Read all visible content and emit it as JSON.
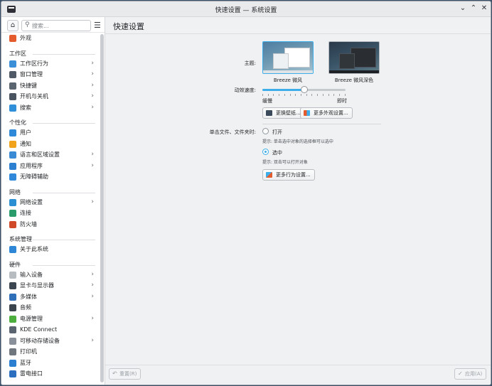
{
  "window": {
    "title": "快速设置 — 系统设置"
  },
  "titlebar": {
    "min_icon": "⌄",
    "max_icon": "⌃",
    "close_icon": "✕"
  },
  "sidebar": {
    "home_icon": "⌂",
    "search_placeholder": "搜索...",
    "search_icon": "⚲",
    "menu_icon": "☰",
    "top_item": {
      "label": "外观",
      "icon_color": "#e45c2e"
    },
    "sections": [
      {
        "title": "工作区",
        "items": [
          {
            "label": "工作区行为",
            "arrow": true,
            "icon_color": "#3b8fd6"
          },
          {
            "label": "窗口管理",
            "arrow": true,
            "icon_color": "#4f5a66"
          },
          {
            "label": "快捷键",
            "arrow": true,
            "icon_color": "#5b6570"
          },
          {
            "label": "开机与关机",
            "arrow": true,
            "icon_color": "#4a5460"
          },
          {
            "label": "搜索",
            "arrow": true,
            "icon_color": "#2f8fd8"
          }
        ]
      },
      {
        "title": "个性化",
        "items": [
          {
            "label": "用户",
            "arrow": false,
            "icon_color": "#2e8ad8"
          },
          {
            "label": "通知",
            "arrow": false,
            "icon_color": "#f1a31b"
          },
          {
            "label": "语言和区域设置",
            "arrow": true,
            "icon_color": "#3a8bd3"
          },
          {
            "label": "应用程序",
            "arrow": true,
            "icon_color": "#2d7fd0"
          },
          {
            "label": "无障碍辅助",
            "arrow": false,
            "icon_color": "#2f88d9"
          }
        ]
      },
      {
        "title": "网络",
        "items": [
          {
            "label": "网络设置",
            "arrow": true,
            "icon_color": "#2b8fd3"
          },
          {
            "label": "连接",
            "arrow": false,
            "icon_color": "#2a9b6a"
          },
          {
            "label": "防火墙",
            "arrow": false,
            "icon_color": "#d04a2a"
          }
        ]
      },
      {
        "title": "系统管理",
        "items": [
          {
            "label": "关于此系统",
            "arrow": false,
            "icon_color": "#2e86d6"
          }
        ]
      },
      {
        "title": "硬件",
        "items": [
          {
            "label": "输入设备",
            "arrow": true,
            "icon_color": "#b7bcc1"
          },
          {
            "label": "显卡与显示器",
            "arrow": true,
            "icon_color": "#3c4650"
          },
          {
            "label": "多媒体",
            "arrow": true,
            "icon_color": "#2f6fb8"
          },
          {
            "label": "音频",
            "arrow": false,
            "icon_color": "#3b434c"
          },
          {
            "label": "电源管理",
            "arrow": true,
            "icon_color": "#4caf3d"
          },
          {
            "label": "KDE Connect",
            "arrow": false,
            "icon_color": "#5a6470"
          },
          {
            "label": "可移动存储设备",
            "arrow": true,
            "icon_color": "#8a9099"
          },
          {
            "label": "打印机",
            "arrow": false,
            "icon_color": "#6f767e"
          },
          {
            "label": "蓝牙",
            "arrow": false,
            "icon_color": "#2c7fd0"
          },
          {
            "label": "雷电接口",
            "arrow": false,
            "icon_color": "#2d6fbf"
          }
        ]
      }
    ]
  },
  "main": {
    "title": "快速设置",
    "theme": {
      "label": "主题:",
      "options": [
        {
          "name": "Breeze 微风",
          "selected": true
        },
        {
          "name": "Breeze 微风深色",
          "selected": false
        }
      ]
    },
    "animation": {
      "label": "动效速度:",
      "slow": "缓慢",
      "fast": "即时",
      "value_fraction": 0.5
    },
    "wallpaper_button": "更换壁纸...",
    "appearance_button": "更多外观设置...",
    "click_behavior": {
      "label": "单击文件、文件夹时:",
      "open_label": "打开",
      "open_hint": "提示: 单击选中对象的选择框可以选中",
      "select_label": "选中",
      "select_hint": "提示: 双击可以打开对象",
      "selected": "select"
    },
    "behavior_button": "更多行为设置...",
    "accent_color": "#3daee9"
  },
  "footer": {
    "reset_label": "重置(R)",
    "reset_icon": "↶",
    "apply_label": "应用(A)",
    "apply_icon": "✓"
  }
}
